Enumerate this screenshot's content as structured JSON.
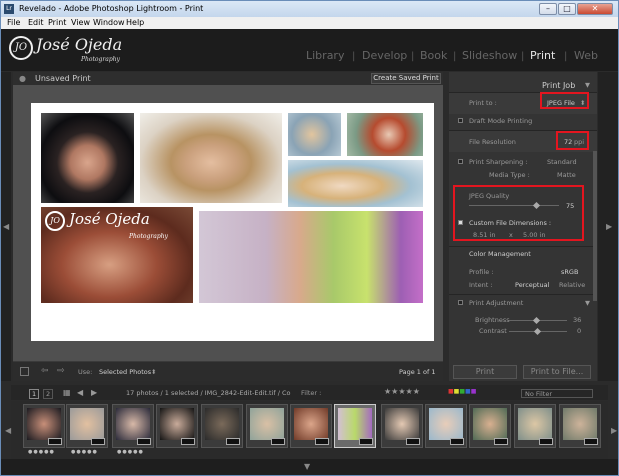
{
  "window": {
    "app_badge": "Lr",
    "title": "Revelado - Adobe Photoshop Lightroom - Print",
    "minimize": "–",
    "maximize": "□",
    "close": "✕"
  },
  "menu": [
    "File",
    "Edit",
    "Print",
    "View",
    "Window",
    "Help"
  ],
  "identity": {
    "monogram": "JO",
    "name": "José Ojeda",
    "subtitle": "Photography"
  },
  "modules": [
    {
      "label": "Library",
      "active": false
    },
    {
      "label": "Develop",
      "active": false
    },
    {
      "label": "Book",
      "active": false
    },
    {
      "label": "Slideshow",
      "active": false
    },
    {
      "label": "Print",
      "active": true
    },
    {
      "label": "Web",
      "active": false
    }
  ],
  "center": {
    "title": "Unsaved Print",
    "save_button": "Create Saved Print",
    "watermark_name": "José Ojeda",
    "watermark_sub": "Photography",
    "watermark_monogram": "JO"
  },
  "toolbar": {
    "use_label": "Use:",
    "use_value": "Selected Photos",
    "page_info": "Page 1 of 1"
  },
  "panel": {
    "header": "Print Job",
    "print_to_label": "Print to :",
    "print_to_value": "JPEG File",
    "draft_mode": "Draft Mode Printing",
    "file_resolution_label": "File Resolution",
    "file_resolution_value": "72",
    "file_resolution_unit": "ppi",
    "print_sharpening": "Print Sharpening :",
    "print_sharpening_value": "Standard",
    "media_type_label": "Media Type :",
    "media_type_value": "Matte",
    "jpeg_quality_label": "JPEG Quality",
    "jpeg_quality_value": "75",
    "jpeg_quality_level": 0.75,
    "custom_dims_label": "Custom File Dimensions :",
    "dim_width": "8.51 in",
    "dim_x": "x",
    "dim_height": "5.00 in",
    "color_management": "Color Management",
    "profile_label": "Profile :",
    "profile_value": "sRGB",
    "intent_label": "Intent :",
    "intent_perceptual": "Perceptual",
    "intent_relative": "Relative",
    "print_adjustment": "Print Adjustment",
    "brightness_label": "Brightness",
    "brightness_value": "36",
    "contrast_label": "Contrast",
    "contrast_value": "0",
    "print_button": "Print",
    "print_to_file_button": "Print to File..."
  },
  "filmstrip": {
    "page1": "1",
    "page2": "2",
    "info": "17 photos / 1 selected / IMG_2842-Edit-Edit.tif / Co",
    "filter_label": "Filter :",
    "filter_value": "No Filter"
  }
}
